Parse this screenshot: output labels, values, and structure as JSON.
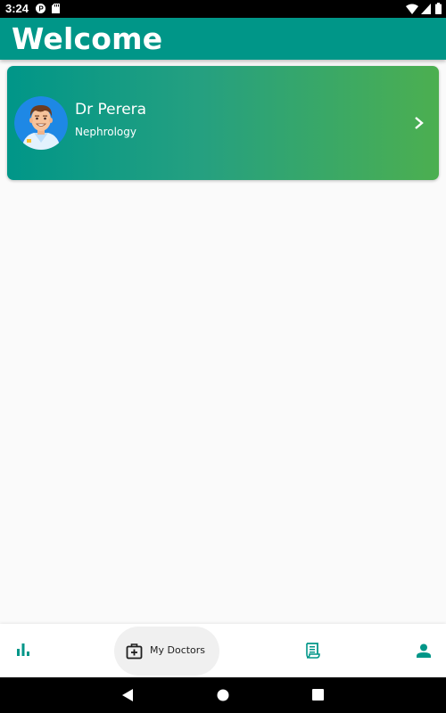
{
  "status_bar": {
    "time": "3:24",
    "icons": [
      "p-notification-icon",
      "sd-card-icon",
      "wifi-icon",
      "signal-icon",
      "battery-icon"
    ]
  },
  "app_bar": {
    "title": "Welcome"
  },
  "doctors": [
    {
      "name": "Dr Perera",
      "specialty": "Nephrology",
      "avatar_icon": "doctor-avatar-icon"
    }
  ],
  "bottom_nav": {
    "items": [
      {
        "icon": "bar-chart-icon",
        "label": "",
        "selected": false
      },
      {
        "icon": "medical-bag-icon",
        "label": "My Doctors",
        "selected": true
      },
      {
        "icon": "receipt-icon",
        "label": "",
        "selected": false
      },
      {
        "icon": "person-icon",
        "label": "",
        "selected": false
      }
    ]
  },
  "system_nav": {
    "icons": [
      "back-icon",
      "home-icon",
      "recents-icon"
    ]
  },
  "colors": {
    "primary": "#009688",
    "gradient_end": "#4caf50",
    "background": "#fafafa"
  }
}
